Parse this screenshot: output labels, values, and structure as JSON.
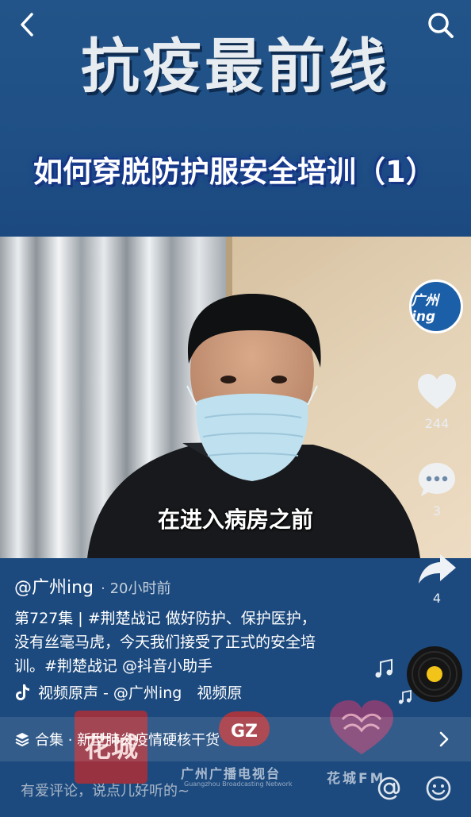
{
  "header": {
    "title": "抗疫最前线",
    "subtitle": "如何穿脱防护服安全培训（1）"
  },
  "video": {
    "caption": "在进入病房之前"
  },
  "side_actions": {
    "avatar_text": "广州 ing",
    "likes": "244",
    "comments": "3",
    "shares": "4"
  },
  "post": {
    "username": "@广州ing",
    "time_ago": "· 20小时前",
    "description_line1": "第727集 | #荆楚战记 做好防护、保护医护，",
    "description_line2": "没有丝毫马虎，今天我们接受了正式的安全培",
    "description_line3": "训。#荆楚战记 @抖音小助手",
    "music": "视频原声 - @广州ing　视频原"
  },
  "collection": {
    "label": "合集 · 新型肺炎疫情硬核干货"
  },
  "comment_bar": {
    "placeholder": "有爱评论，说点儿好听的~"
  },
  "watermarks": {
    "channel_name": "广州广播电视台",
    "channel_en": "Guangzhou Broadcasting Network",
    "radio_name": "花城FM",
    "logo_gz": "GZ",
    "logo_huacheng": "花城"
  },
  "colors": {
    "banner": "#225489",
    "bottom_bg": "#1d4a7e",
    "accent_disc": "#f2c318"
  }
}
